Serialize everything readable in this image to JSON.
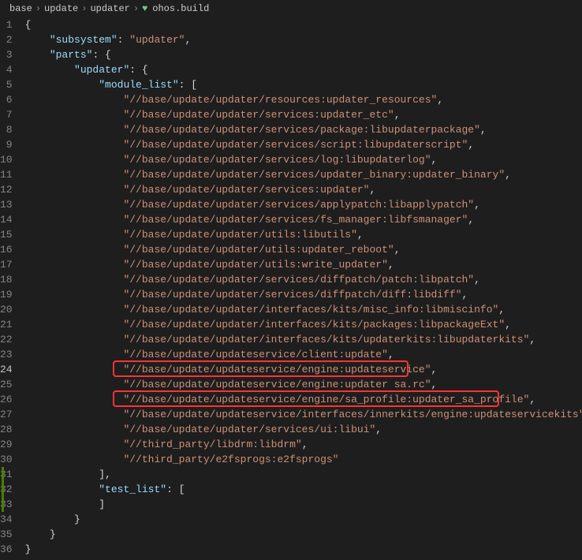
{
  "breadcrumb": {
    "parts": [
      "base",
      "update",
      "updater"
    ],
    "file": "ohos.build"
  },
  "activeLine": 24,
  "modifiedRange": {
    "start": 31,
    "end": 33
  },
  "highlights": [
    {
      "line": 24,
      "startCh": 12,
      "endCh": 53
    },
    {
      "line": 26,
      "startCh": 12,
      "endCh": 68
    }
  ],
  "lines": [
    {
      "n": 1,
      "indent": 0,
      "tokens": [
        {
          "t": "p",
          "v": "{"
        }
      ]
    },
    {
      "n": 2,
      "indent": 1,
      "tokens": [
        {
          "t": "k",
          "v": "\"subsystem\""
        },
        {
          "t": "p",
          "v": ": "
        },
        {
          "t": "s",
          "v": "\"updater\""
        },
        {
          "t": "p",
          "v": ","
        }
      ]
    },
    {
      "n": 3,
      "indent": 1,
      "tokens": [
        {
          "t": "k",
          "v": "\"parts\""
        },
        {
          "t": "p",
          "v": ": {"
        }
      ]
    },
    {
      "n": 4,
      "indent": 2,
      "tokens": [
        {
          "t": "k",
          "v": "\"updater\""
        },
        {
          "t": "p",
          "v": ": {"
        }
      ]
    },
    {
      "n": 5,
      "indent": 3,
      "tokens": [
        {
          "t": "k",
          "v": "\"module_list\""
        },
        {
          "t": "p",
          "v": ": ["
        }
      ]
    },
    {
      "n": 6,
      "indent": 4,
      "tokens": [
        {
          "t": "s",
          "v": "\"//base/update/updater/resources:updater_resources\""
        },
        {
          "t": "p",
          "v": ","
        }
      ]
    },
    {
      "n": 7,
      "indent": 4,
      "tokens": [
        {
          "t": "s",
          "v": "\"//base/update/updater/services:updater_etc\""
        },
        {
          "t": "p",
          "v": ","
        }
      ]
    },
    {
      "n": 8,
      "indent": 4,
      "tokens": [
        {
          "t": "s",
          "v": "\"//base/update/updater/services/package:libupdaterpackage\""
        },
        {
          "t": "p",
          "v": ","
        }
      ]
    },
    {
      "n": 9,
      "indent": 4,
      "tokens": [
        {
          "t": "s",
          "v": "\"//base/update/updater/services/script:libupdaterscript\""
        },
        {
          "t": "p",
          "v": ","
        }
      ]
    },
    {
      "n": 10,
      "indent": 4,
      "tokens": [
        {
          "t": "s",
          "v": "\"//base/update/updater/services/log:libupdaterlog\""
        },
        {
          "t": "p",
          "v": ","
        }
      ]
    },
    {
      "n": 11,
      "indent": 4,
      "tokens": [
        {
          "t": "s",
          "v": "\"//base/update/updater/services/updater_binary:updater_binary\""
        },
        {
          "t": "p",
          "v": ","
        }
      ]
    },
    {
      "n": 12,
      "indent": 4,
      "tokens": [
        {
          "t": "s",
          "v": "\"//base/update/updater/services:updater\""
        },
        {
          "t": "p",
          "v": ","
        }
      ]
    },
    {
      "n": 13,
      "indent": 4,
      "tokens": [
        {
          "t": "s",
          "v": "\"//base/update/updater/services/applypatch:libapplypatch\""
        },
        {
          "t": "p",
          "v": ","
        }
      ]
    },
    {
      "n": 14,
      "indent": 4,
      "tokens": [
        {
          "t": "s",
          "v": "\"//base/update/updater/services/fs_manager:libfsmanager\""
        },
        {
          "t": "p",
          "v": ","
        }
      ]
    },
    {
      "n": 15,
      "indent": 4,
      "tokens": [
        {
          "t": "s",
          "v": "\"//base/update/updater/utils:libutils\""
        },
        {
          "t": "p",
          "v": ","
        }
      ]
    },
    {
      "n": 16,
      "indent": 4,
      "tokens": [
        {
          "t": "s",
          "v": "\"//base/update/updater/utils:updater_reboot\""
        },
        {
          "t": "p",
          "v": ","
        }
      ]
    },
    {
      "n": 17,
      "indent": 4,
      "tokens": [
        {
          "t": "s",
          "v": "\"//base/update/updater/utils:write_updater\""
        },
        {
          "t": "p",
          "v": ","
        }
      ]
    },
    {
      "n": 18,
      "indent": 4,
      "tokens": [
        {
          "t": "s",
          "v": "\"//base/update/updater/services/diffpatch/patch:libpatch\""
        },
        {
          "t": "p",
          "v": ","
        }
      ]
    },
    {
      "n": 19,
      "indent": 4,
      "tokens": [
        {
          "t": "s",
          "v": "\"//base/update/updater/services/diffpatch/diff:libdiff\""
        },
        {
          "t": "p",
          "v": ","
        }
      ]
    },
    {
      "n": 20,
      "indent": 4,
      "tokens": [
        {
          "t": "s",
          "v": "\"//base/update/updater/interfaces/kits/misc_info:libmiscinfo\""
        },
        {
          "t": "p",
          "v": ","
        }
      ]
    },
    {
      "n": 21,
      "indent": 4,
      "tokens": [
        {
          "t": "s",
          "v": "\"//base/update/updater/interfaces/kits/packages:libpackageExt\""
        },
        {
          "t": "p",
          "v": ","
        }
      ]
    },
    {
      "n": 22,
      "indent": 4,
      "tokens": [
        {
          "t": "s",
          "v": "\"//base/update/updater/interfaces/kits/updaterkits:libupdaterkits\""
        },
        {
          "t": "p",
          "v": ","
        }
      ]
    },
    {
      "n": 23,
      "indent": 4,
      "tokens": [
        {
          "t": "s",
          "v": "\"//base/update/updateservice/client:update\""
        },
        {
          "t": "p",
          "v": ","
        }
      ]
    },
    {
      "n": 24,
      "indent": 4,
      "tokens": [
        {
          "t": "s",
          "v": "\"//base/update/updateservice/engine:updateservice\""
        },
        {
          "t": "p",
          "v": ","
        }
      ]
    },
    {
      "n": 25,
      "indent": 4,
      "tokens": [
        {
          "t": "s",
          "v": "\"//base/update/updateservice/engine:updater sa.rc\""
        },
        {
          "t": "p",
          "v": ","
        }
      ]
    },
    {
      "n": 26,
      "indent": 4,
      "tokens": [
        {
          "t": "s",
          "v": "\"//base/update/updateservice/engine/sa_profile:updater_sa_profile\""
        },
        {
          "t": "p",
          "v": ","
        }
      ]
    },
    {
      "n": 27,
      "indent": 4,
      "tokens": [
        {
          "t": "s",
          "v": "\"//base/update/updateservice/interfaces/innerkits/engine:updateservicekits\""
        },
        {
          "t": "p",
          "v": ","
        }
      ]
    },
    {
      "n": 28,
      "indent": 4,
      "tokens": [
        {
          "t": "s",
          "v": "\"//base/update/updater/services/ui:libui\""
        },
        {
          "t": "p",
          "v": ","
        }
      ]
    },
    {
      "n": 29,
      "indent": 4,
      "tokens": [
        {
          "t": "s",
          "v": "\"//third_party/libdrm:libdrm\""
        },
        {
          "t": "p",
          "v": ","
        }
      ]
    },
    {
      "n": 30,
      "indent": 4,
      "tokens": [
        {
          "t": "s",
          "v": "\"//third_party/e2fsprogs:e2fsprogs\""
        }
      ]
    },
    {
      "n": 31,
      "indent": 3,
      "tokens": [
        {
          "t": "p",
          "v": "],"
        }
      ]
    },
    {
      "n": 32,
      "indent": 3,
      "tokens": [
        {
          "t": "k",
          "v": "\"test_list\""
        },
        {
          "t": "p",
          "v": ": ["
        }
      ]
    },
    {
      "n": 33,
      "indent": 3,
      "tokens": [
        {
          "t": "p",
          "v": "]"
        }
      ]
    },
    {
      "n": 34,
      "indent": 2,
      "tokens": [
        {
          "t": "p",
          "v": "}"
        }
      ]
    },
    {
      "n": 35,
      "indent": 1,
      "tokens": [
        {
          "t": "p",
          "v": "}"
        }
      ]
    },
    {
      "n": 36,
      "indent": 0,
      "tokens": [
        {
          "t": "p",
          "v": "}"
        }
      ]
    }
  ]
}
